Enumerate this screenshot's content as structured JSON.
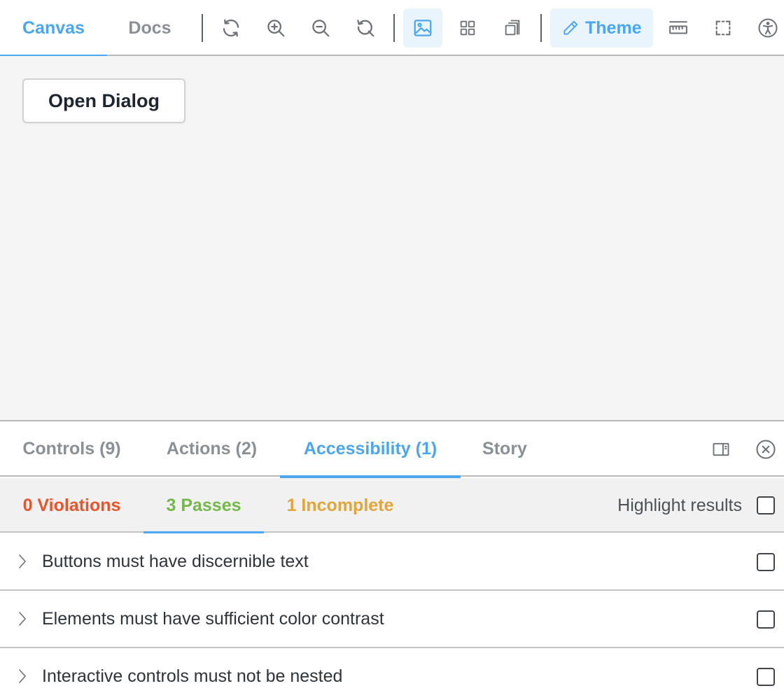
{
  "toolbar": {
    "tabs": [
      {
        "label": "Canvas",
        "active": true
      },
      {
        "label": "Docs",
        "active": false
      }
    ],
    "tools": [
      {
        "icon": "reload-icon"
      },
      {
        "icon": "zoom-in-icon"
      },
      {
        "icon": "zoom-out-icon"
      },
      {
        "icon": "reset-zoom-icon"
      },
      {
        "icon": "background-image-icon",
        "active": true
      },
      {
        "icon": "grid-icon"
      },
      {
        "icon": "viewport-icon"
      },
      {
        "icon": "measure-ruler-icon"
      },
      {
        "icon": "outline-icon"
      },
      {
        "icon": "accessibility-icon"
      }
    ],
    "theme_label": "Theme"
  },
  "canvas": {
    "open_dialog_label": "Open Dialog"
  },
  "addons": {
    "tabs": [
      {
        "label": "Controls (9)",
        "active": false
      },
      {
        "label": "Actions (2)",
        "active": false
      },
      {
        "label": "Accessibility (1)",
        "active": true
      },
      {
        "label": "Story",
        "active": false
      }
    ]
  },
  "a11y": {
    "tabs": [
      {
        "label": "0 Violations",
        "color": "#e8542b"
      },
      {
        "label": "3 Passes",
        "color": "#74b74b",
        "active": true
      },
      {
        "label": "1 Incomplete",
        "color": "#e0a53c"
      }
    ],
    "highlight_label": "Highlight results",
    "rules": [
      {
        "label": "Buttons must have discernible text"
      },
      {
        "label": "Elements must have sufficient color contrast"
      },
      {
        "label": "Interactive controls must not be nested"
      }
    ]
  },
  "colors": {
    "accent": "#4aa6ee",
    "violations": "#e8542b",
    "passes": "#74b74b",
    "incomplete": "#e0a53c"
  }
}
